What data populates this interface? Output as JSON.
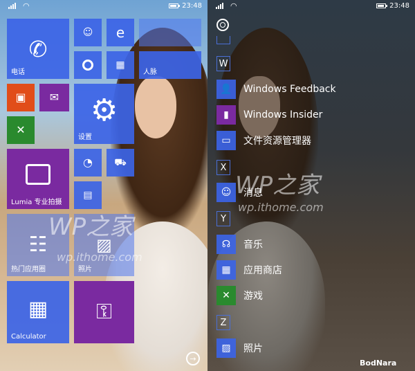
{
  "left": {
    "status": {
      "time": "23:48"
    },
    "tiles": {
      "phone": "电话",
      "people": "人脉",
      "settings": "设置",
      "lumia": "Lumia 专业拍摄",
      "hot_apps": "热门应用圈",
      "photos": "照片",
      "calculator": "Calculator"
    },
    "nav_arrow": "→"
  },
  "right": {
    "status": {
      "time": "23:48"
    },
    "apps": [
      {
        "letter": "W",
        "label": "W"
      },
      {
        "label": "Windows Feedback",
        "icon": "feedback-icon"
      },
      {
        "label": "Windows Insider",
        "icon": "insider-icon"
      },
      {
        "label": "文件资源管理器",
        "icon": "file-explorer-icon"
      },
      {
        "letter": "X",
        "label": "X"
      },
      {
        "label": "消息",
        "icon": "messaging-icon"
      },
      {
        "letter": "Y",
        "label": "Y"
      },
      {
        "label": "音乐",
        "icon": "headphones-icon"
      },
      {
        "label": "应用商店",
        "icon": "store-icon"
      },
      {
        "label": "游戏",
        "icon": "xbox-icon"
      },
      {
        "letter": "Z",
        "label": "Z"
      },
      {
        "label": "照片",
        "icon": "photos-icon"
      }
    ]
  },
  "watermark": {
    "main": "WP之家",
    "url": "wp.ithome.com"
  },
  "brand": "BodNara",
  "colors": {
    "accent_blue": "#3c64e6",
    "purple": "#7a2aa0",
    "orange": "#e14d19",
    "green": "#2a8a2e"
  }
}
